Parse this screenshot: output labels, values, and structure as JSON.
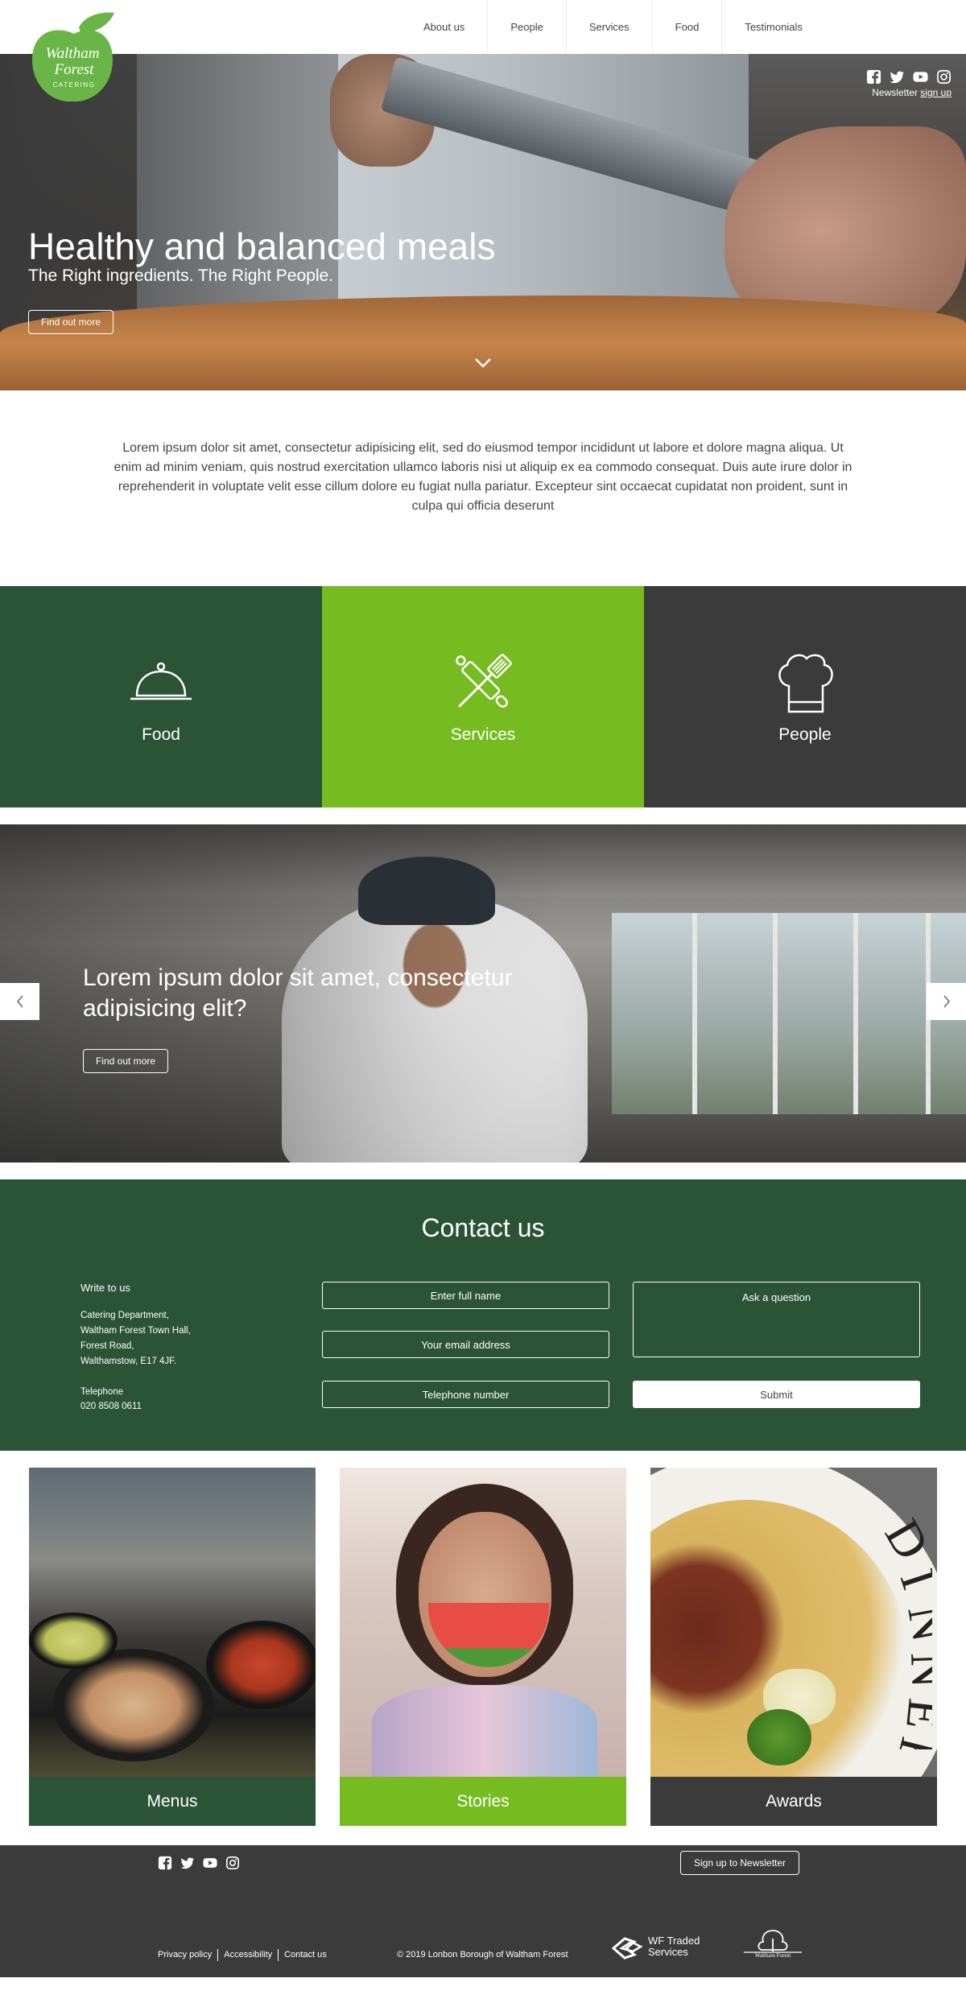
{
  "nav": {
    "items": [
      {
        "label": "About us"
      },
      {
        "label": "People"
      },
      {
        "label": "Services"
      },
      {
        "label": "Food"
      },
      {
        "label": "Testimonials"
      }
    ]
  },
  "logo": {
    "line1": "Waltham",
    "line2": "Forest",
    "line3": "CATERING"
  },
  "colors": {
    "dark_green": "#2b5335",
    "lime": "#76bc21",
    "charcoal": "#3b3b3b",
    "logo_green": "#6ab547"
  },
  "social": {
    "icons": [
      "facebook-icon",
      "twitter-icon",
      "youtube-icon",
      "instagram-icon"
    ],
    "newsletter_prefix": "Newsletter",
    "newsletter_link": "sign up"
  },
  "hero": {
    "title": "Healthy and balanced meals",
    "subtitle": "The Right ingredients. The Right People.",
    "button": "Find out more"
  },
  "intro": {
    "text": "Lorem ipsum dolor sit amet, consectetur adipisicing elit, sed do eiusmod tempor incididunt ut labore et dolore magna aliqua. Ut enim ad minim veniam, quis nostrud exercitation ullamco laboris nisi ut aliquip ex ea commodo consequat. Duis aute irure dolor in reprehenderit in voluptate velit esse cillum dolore eu fugiat nulla pariatur. Excepteur sint occaecat cupidatat non proident, sunt in culpa qui officia deserunt"
  },
  "tiles": [
    {
      "label": "Food",
      "icon": "cloche-icon"
    },
    {
      "label": "Services",
      "icon": "utensils-icon"
    },
    {
      "label": "People",
      "icon": "chef-hat-icon"
    }
  ],
  "slider": {
    "title": "Lorem ipsum dolor sit amet, consectetur adipisicing elit?",
    "button": "Find out more"
  },
  "contact": {
    "heading": "Contact us",
    "write_label": "Write to us",
    "address": [
      "Catering Department,",
      "Waltham Forest Town Hall,",
      "Forest Road,",
      "Walthamstow, E17 4JF."
    ],
    "telephone_label": "Telephone",
    "telephone": "020 8508 0611",
    "name_placeholder": "Enter full name",
    "email_placeholder": "Your email address",
    "phone_placeholder": "Telephone number",
    "question_placeholder": "Ask a question",
    "submit": "Submit"
  },
  "cards": [
    {
      "label": "Menus"
    },
    {
      "label": "Stories"
    },
    {
      "label": "Awards"
    }
  ],
  "footer": {
    "newsletter_button": "Sign up to Newsletter",
    "links": [
      "Privacy policy",
      "Accessibility",
      "Contact us"
    ],
    "copyright": "© 2019 Lonbon Borough of Waltham Forest",
    "traded_line1": "WF Traded",
    "traded_line2": "Services",
    "council_name": "Waltham Forest"
  }
}
